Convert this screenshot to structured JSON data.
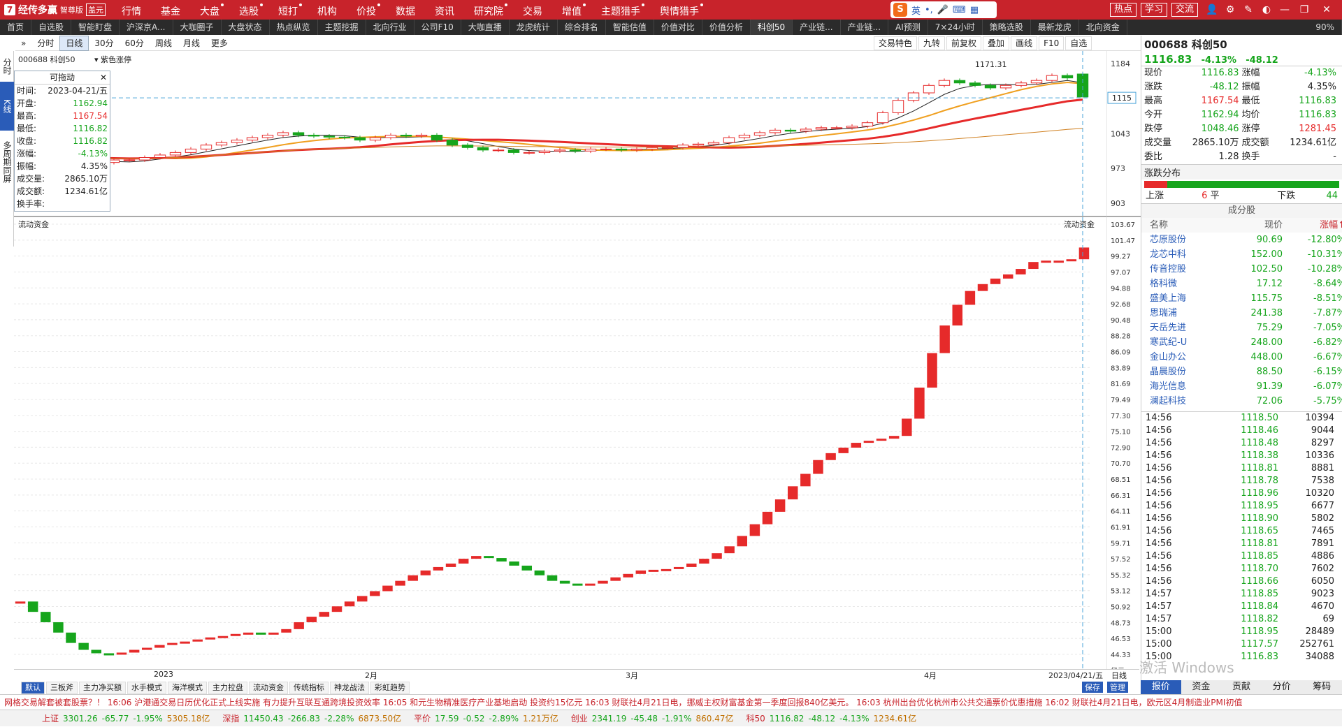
{
  "app": {
    "logo": "经传多赢",
    "edition": "智尊版",
    "badge": "盖元",
    "menu": [
      {
        "label": "行情",
        "dot": false
      },
      {
        "label": "基金",
        "dot": false
      },
      {
        "label": "大盘",
        "dot": true
      },
      {
        "label": "选股",
        "dot": true
      },
      {
        "label": "短打",
        "dot": true
      },
      {
        "label": "机构",
        "dot": false
      },
      {
        "label": "价投",
        "dot": true
      },
      {
        "label": "数据",
        "dot": false
      },
      {
        "label": "资讯",
        "dot": false
      },
      {
        "label": "研究院",
        "dot": true
      },
      {
        "label": "交易",
        "dot": false
      },
      {
        "label": "增值",
        "dot": true
      },
      {
        "label": "主题猎手",
        "dot": true
      },
      {
        "label": "舆情猎手",
        "dot": true
      }
    ],
    "ime": {
      "s": "S",
      "lang": "英",
      "punct": "•,"
    },
    "right_buttons": [
      "热点",
      "学习",
      "交流"
    ]
  },
  "nav": {
    "tabs": [
      "首页",
      "自选股",
      "智能盯盘",
      "沪深京A...",
      "大咖圈子",
      "大盘状态",
      "热点纵览",
      "主题挖掘",
      "北向行业",
      "公司F10",
      "大咖直播",
      "龙虎统计",
      "综合排名",
      "智能估值",
      "价值对比",
      "价值分析",
      "科创50",
      "产业链...",
      "产业链...",
      "AI预测",
      "7×24小时",
      "策略选股",
      "最新龙虎",
      "北向资金"
    ],
    "active": "科创50",
    "zoom": "90%"
  },
  "toolbar": {
    "periods": [
      "分时",
      "日线",
      "30分",
      "60分",
      "周线",
      "月线",
      "更多"
    ],
    "active": "日线",
    "right": [
      "交易特色",
      "九转",
      "前复权",
      "叠加",
      "画线",
      "F10",
      "自选"
    ]
  },
  "left_tabs": [
    "分时",
    "K线",
    "多周期同屏"
  ],
  "chart": {
    "code": "000688",
    "name": "科创50",
    "title": "000688 科创50",
    "overlay_label": "紫色涨停",
    "hi_label": "1171.31",
    "cursor_price": "1115",
    "price_ticks": [
      "1184",
      "1043",
      "973",
      "903"
    ],
    "flow_title": "流动资金",
    "flow_ticks": [
      "103.67",
      "101.47",
      "99.27",
      "97.07",
      "94.88",
      "92.68",
      "90.48",
      "88.28",
      "86.09",
      "83.89",
      "81.69",
      "79.49",
      "77.30",
      "75.10",
      "72.90",
      "70.70",
      "68.51",
      "66.31",
      "64.11",
      "61.91",
      "59.71",
      "57.52",
      "55.32",
      "53.12",
      "50.92",
      "48.73",
      "46.53",
      "44.33",
      "亿元"
    ],
    "dates": [
      "2023",
      "2月",
      "3月",
      "4月",
      "2023/04/21/五",
      "日线"
    ],
    "indicators": [
      "默认",
      "三板斧",
      "主力净买额",
      "水手模式",
      "海洋模式",
      "主力拉盘",
      "流动资金",
      "传统指标",
      "神龙战法",
      "彩虹趋势"
    ],
    "active_indicator": "流动资金",
    "extra_buttons": [
      "保存",
      "管理"
    ]
  },
  "infobox": {
    "header": "可拖动",
    "rows": [
      {
        "k": "时间:",
        "v": "2023-04-21/五",
        "c": ""
      },
      {
        "k": "开盘:",
        "v": "1162.94",
        "c": "green"
      },
      {
        "k": "最高:",
        "v": "1167.54",
        "c": "red"
      },
      {
        "k": "最低:",
        "v": "1116.82",
        "c": "green"
      },
      {
        "k": "收盘:",
        "v": "1116.82",
        "c": "green"
      },
      {
        "k": "涨幅:",
        "v": "-4.13%",
        "c": "green"
      },
      {
        "k": "振幅:",
        "v": "4.35%",
        "c": ""
      },
      {
        "k": "成交量:",
        "v": "2865.10万",
        "c": ""
      },
      {
        "k": "成交额:",
        "v": "1234.61亿",
        "c": ""
      },
      {
        "k": "换手率:",
        "v": "",
        "c": ""
      }
    ]
  },
  "quote": {
    "title": "000688 科创50",
    "price": "1116.83",
    "chg_pct": "-4.13%",
    "chg": "-48.12",
    "grid": [
      [
        "现价",
        "1116.83",
        "涨幅",
        "-4.13%"
      ],
      [
        "涨跌",
        "-48.12",
        "振幅",
        "4.35%"
      ],
      [
        "最高",
        "1167.54",
        "最低",
        "1116.83"
      ],
      [
        "今开",
        "1162.94",
        "均价",
        "1116.83"
      ],
      [
        "跌停",
        "1048.46",
        "涨停",
        "1281.45"
      ],
      [
        "成交量",
        "2865.10万",
        "成交额",
        "1234.61亿"
      ],
      [
        "委比",
        "1.28",
        "换手",
        "-"
      ]
    ],
    "dist_title": "涨跌分布",
    "up_label": "上涨",
    "up": "6",
    "flat_label": "平",
    "down_label": "下跌",
    "down": "44",
    "cons_title": "成分股",
    "cons_headers": [
      "名称",
      "现价",
      "涨幅↑"
    ],
    "constituents": [
      [
        "芯原股份",
        "90.69",
        "-12.80%"
      ],
      [
        "龙芯中科",
        "152.00",
        "-10.31%"
      ],
      [
        "传音控股",
        "102.50",
        "-10.28%"
      ],
      [
        "格科微",
        "17.12",
        "-8.64%"
      ],
      [
        "盛美上海",
        "115.75",
        "-8.51%"
      ],
      [
        "思瑞浦",
        "241.38",
        "-7.87%"
      ],
      [
        "天岳先进",
        "75.29",
        "-7.05%"
      ],
      [
        "寒武纪-U",
        "248.00",
        "-6.82%"
      ],
      [
        "金山办公",
        "448.00",
        "-6.67%"
      ],
      [
        "晶晨股份",
        "88.50",
        "-6.15%"
      ],
      [
        "海光信息",
        "91.39",
        "-6.07%"
      ],
      [
        "澜起科技",
        "72.06",
        "-5.75%"
      ]
    ],
    "ticks": [
      [
        "14:56",
        "1118.50",
        "10394"
      ],
      [
        "14:56",
        "1118.46",
        "9044"
      ],
      [
        "14:56",
        "1118.48",
        "8297"
      ],
      [
        "14:56",
        "1118.38",
        "10336"
      ],
      [
        "14:56",
        "1118.81",
        "8881"
      ],
      [
        "14:56",
        "1118.78",
        "7538"
      ],
      [
        "14:56",
        "1118.96",
        "10320"
      ],
      [
        "14:56",
        "1118.95",
        "6677"
      ],
      [
        "14:56",
        "1118.90",
        "5802"
      ],
      [
        "14:56",
        "1118.65",
        "7465"
      ],
      [
        "14:56",
        "1118.81",
        "7891"
      ],
      [
        "14:56",
        "1118.85",
        "4886"
      ],
      [
        "14:56",
        "1118.70",
        "7602"
      ],
      [
        "14:56",
        "1118.66",
        "6050"
      ],
      [
        "14:57",
        "1118.85",
        "9023"
      ],
      [
        "14:57",
        "1118.84",
        "4670"
      ],
      [
        "14:57",
        "1118.82",
        "69"
      ],
      [
        "15:00",
        "1118.95",
        "28489"
      ],
      [
        "15:00",
        "1117.57",
        "252761"
      ],
      [
        "15:00",
        "1116.83",
        "34088"
      ]
    ],
    "tabs": [
      "报价",
      "资金",
      "贡献",
      "分价",
      "筹码"
    ],
    "active_tab": "报价"
  },
  "news": "网格交易解套被套股票？！   16:06 沪港通交易日历优化正式上线实施 有力提升互联互通跨境投资效率   16:05 和元生物精准医疗产业基地启动 投资约15亿元   16:03 财联社4月21日电，挪威主权财富基金第一季度回报840亿美元。   16:03 杭州出台优化杭州市公共交通票价优惠措施   16:02 财联社4月21日电，欧元区4月制造业PMI初值",
  "status": [
    {
      "name": "上证",
      "val": "3301.26",
      "chg": "-65.77",
      "pct": "-1.95%",
      "amt": "5305.18亿"
    },
    {
      "name": "深指",
      "val": "11450.43",
      "chg": "-266.83",
      "pct": "-2.28%",
      "amt": "6873.50亿"
    },
    {
      "name": "平价",
      "val": "17.59",
      "chg": "-0.52",
      "pct": "-2.89%",
      "amt": "1.21万亿"
    },
    {
      "name": "创业",
      "val": "2341.19",
      "chg": "-45.48",
      "pct": "-1.91%",
      "amt": "860.47亿"
    },
    {
      "name": "科50",
      "val": "1116.82",
      "chg": "-48.12",
      "pct": "-4.13%",
      "amt": "1234.61亿"
    }
  ],
  "watermark": "激活 Windows",
  "colors": {
    "up": "#e62a2a",
    "down": "#16a51c",
    "accent": "#2a5cb8",
    "brand": "#c8232b"
  },
  "chart_data": [
    {
      "type": "candlestick",
      "title": "000688 科创50",
      "ylim": [
        903,
        1184
      ],
      "highlight": {
        "label": "1171.31",
        "value": 1171.31
      },
      "last": {
        "open": 1162.94,
        "high": 1167.54,
        "low": 1116.82,
        "close": 1116.82
      },
      "close_series": [
        1015,
        1005,
        995,
        985,
        980,
        985,
        990,
        990,
        995,
        1000,
        1005,
        1012,
        1020,
        1025,
        1030,
        1035,
        1040,
        1045,
        1040,
        1038,
        1036,
        1035,
        1030,
        1035,
        1040,
        1038,
        1040,
        1030,
        1020,
        1015,
        1010,
        1010,
        1005,
        1005,
        1008,
        1010,
        1008,
        1012,
        1012,
        1010,
        1012,
        1015,
        1015,
        1020,
        1022,
        1025,
        1035,
        1040,
        1045,
        1050,
        1048,
        1052,
        1055,
        1055,
        1058,
        1065,
        1085,
        1110,
        1125,
        1140,
        1150,
        1145,
        1140,
        1135,
        1140,
        1145,
        1150,
        1160,
        1155,
        1116.82
      ]
    },
    {
      "type": "bar",
      "title": "流动资金",
      "ylim": [
        44.33,
        103.67
      ],
      "ylabel": "亿元",
      "values": [
        52,
        50.5,
        49,
        47.5,
        46,
        45,
        44.5,
        44.3,
        44.6,
        45,
        45.3,
        45.7,
        46,
        46.2,
        46.5,
        46.8,
        47,
        47.3,
        47.5,
        47.2,
        47.5,
        48,
        49,
        49.8,
        50.5,
        51.3,
        52,
        52.8,
        53.5,
        54.3,
        55,
        55.8,
        56.5,
        57,
        57.5,
        58.2,
        58.6,
        58.3,
        57.8,
        57.2,
        56.5,
        55.8,
        55,
        54.6,
        54.3,
        54.6,
        55,
        55.5,
        56,
        56.5,
        56.6,
        56.7,
        57,
        57.5,
        58.2,
        59,
        60,
        61.5,
        63.2,
        65,
        66.8,
        68.7,
        70.5,
        72.5,
        73.5,
        74.3,
        75,
        75.3,
        75.6,
        76,
        78.5,
        83,
        88,
        92,
        95,
        97,
        98,
        98.8,
        99.4,
        100.2,
        101.2,
        101.4,
        101.4,
        101.6,
        103.3
      ]
    }
  ]
}
